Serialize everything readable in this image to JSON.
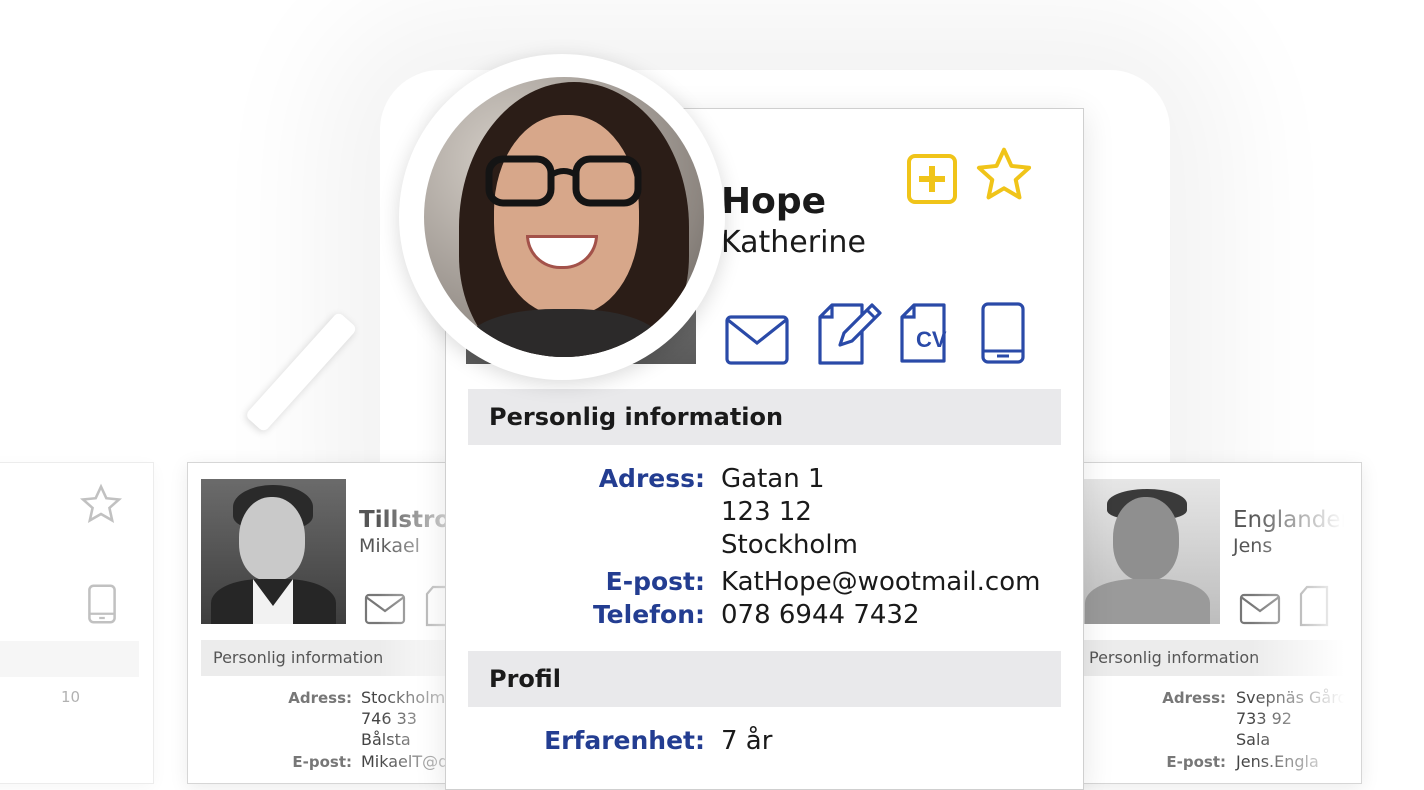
{
  "colors": {
    "label_blue": "#233d91",
    "icon_blue": "#2a4aa8",
    "accent_yellow": "#f0c419",
    "section_gray": "#e9e9eb"
  },
  "main_profile": {
    "last_name": "Hope",
    "first_name": "Katherine",
    "icons": [
      "add-icon",
      "star-icon",
      "mail-icon",
      "edit-document-icon",
      "cv-icon",
      "tablet-icon"
    ],
    "cv_text": "CV",
    "sections": {
      "personal": {
        "title": "Personlig information",
        "address_label": "Adress:",
        "address_lines": [
          "Gatan 1",
          "123 12",
          "Stockholm"
        ],
        "email_label": "E-post:",
        "email": "KatHope@wootmail.com",
        "phone_label": "Telefon:",
        "phone": "078 6944 7432"
      },
      "profile": {
        "title": "Profil",
        "experience_label": "Erfarenhet:",
        "experience": "7 år"
      }
    }
  },
  "left_card": {
    "last_name": "Tillstrom",
    "first_name": "Mikael",
    "section_title": "Personlig information",
    "address_label": "Adress:",
    "address_lines": [
      "Stockholm",
      "746 33",
      "Bålsta"
    ],
    "email_label": "E-post:",
    "email": "MikaelT@d"
  },
  "right_card": {
    "last_name": "Englander",
    "first_name": "Jens",
    "section_title": "Personlig information",
    "address_label": "Adress:",
    "address_lines": [
      "Svepnäs Gård",
      "733 92",
      "Sala"
    ],
    "email_label": "E-post:",
    "email": "Jens.Engla"
  },
  "far_left_card": {
    "partial_text": "10"
  }
}
